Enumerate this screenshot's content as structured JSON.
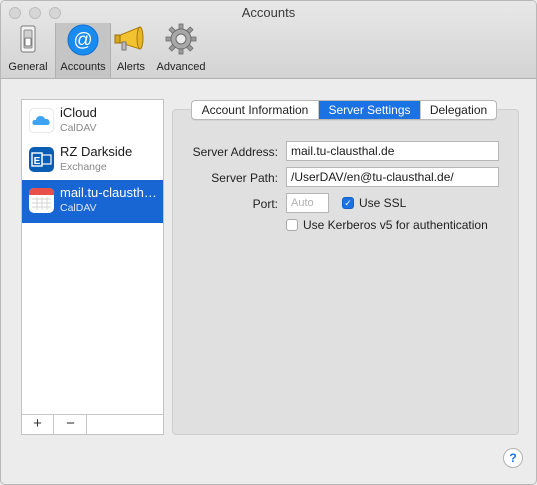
{
  "window": {
    "title": "Accounts"
  },
  "toolbar": {
    "items": [
      {
        "label": "General",
        "icon": "general-switch-icon"
      },
      {
        "label": "Accounts",
        "icon": "at-sign-icon",
        "selected": true
      },
      {
        "label": "Alerts",
        "icon": "megaphone-icon"
      },
      {
        "label": "Advanced",
        "icon": "gear-icon"
      }
    ]
  },
  "accounts": [
    {
      "name": "iCloud",
      "type": "CalDAV",
      "icon": "icloud-icon"
    },
    {
      "name": "RZ Darkside",
      "type": "Exchange",
      "icon": "exchange-icon"
    },
    {
      "name": "mail.tu-clausthal.de",
      "type": "CalDAV",
      "icon": "calendar-icon",
      "selected": true
    }
  ],
  "list_controls": {
    "add": "+",
    "remove": "−"
  },
  "tabs": [
    {
      "label": "Account Information"
    },
    {
      "label": "Server Settings",
      "active": true
    },
    {
      "label": "Delegation"
    }
  ],
  "server_settings": {
    "address_label": "Server Address:",
    "address_value": "mail.tu-clausthal.de",
    "path_label": "Server Path:",
    "path_value": "/UserDAV/en@tu-clausthal.de/",
    "port_label": "Port:",
    "port_placeholder": "Auto",
    "ssl_label": "Use SSL",
    "ssl_checked": true,
    "kerberos_label": "Use Kerberos v5 for authentication",
    "kerberos_checked": false
  },
  "help": {
    "label": "?"
  },
  "colors": {
    "accent": "#1a72e3",
    "selection": "#1766d4"
  }
}
